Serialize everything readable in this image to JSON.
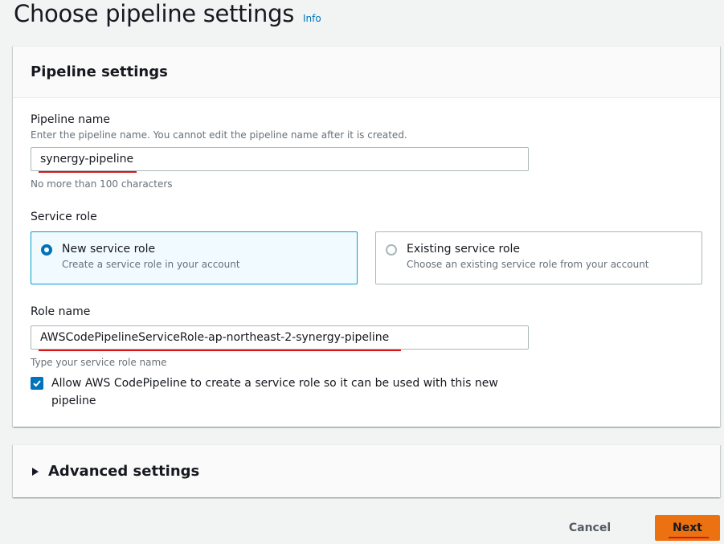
{
  "page": {
    "title": "Choose pipeline settings",
    "info_link": "Info"
  },
  "pipeline_settings": {
    "title": "Pipeline settings",
    "pipeline_name": {
      "label": "Pipeline name",
      "description": "Enter the pipeline name. You cannot edit the pipeline name after it is created.",
      "value": "synergy-pipeline",
      "constraint": "No more than 100 characters"
    },
    "service_role": {
      "label": "Service role",
      "options": [
        {
          "title": "New service role",
          "description": "Create a service role in your account",
          "selected": true
        },
        {
          "title": "Existing service role",
          "description": "Choose an existing service role from your account",
          "selected": false
        }
      ]
    },
    "role_name": {
      "label": "Role name",
      "value": "AWSCodePipelineServiceRole-ap-northeast-2-synergy-pipeline",
      "hint": "Type your service role name"
    },
    "allow_checkbox": {
      "label": "Allow AWS CodePipeline to create a service role so it can be used with this new pipeline",
      "checked": true
    }
  },
  "advanced_settings": {
    "title": "Advanced settings",
    "expanded": false
  },
  "footer": {
    "cancel_label": "Cancel",
    "next_label": "Next"
  },
  "colors": {
    "accent": "#0073bb",
    "primary_button": "#ec7211",
    "annotation": "#d91515",
    "selected_tile_border": "#00a1c9"
  }
}
